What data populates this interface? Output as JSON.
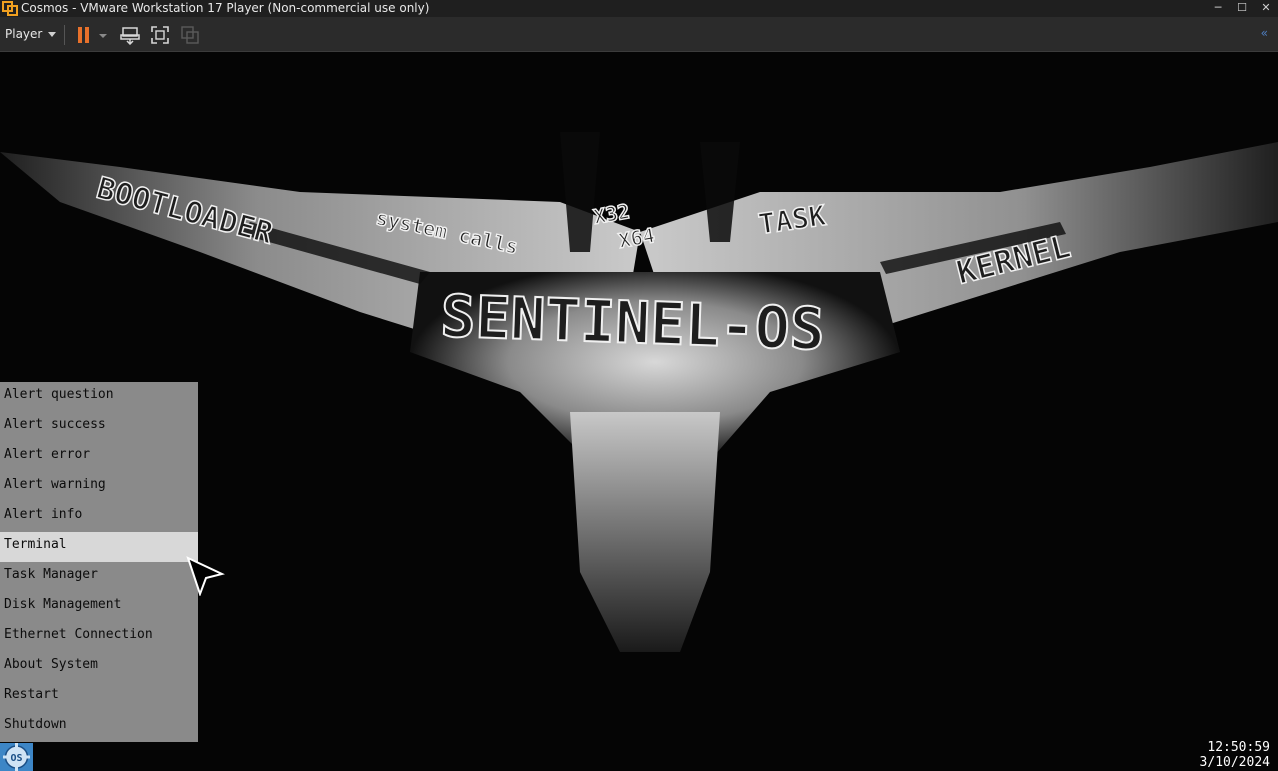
{
  "window": {
    "title": "Cosmos - VMware Workstation 17 Player (Non-commercial use only)",
    "controls": {
      "minimize": "─",
      "maximize": "☐",
      "close": "✕"
    }
  },
  "toolbar": {
    "player_label": "Player",
    "icons": [
      "pause-icon",
      "dropdown-arrow-icon",
      "send-ctrl-alt-del-icon",
      "fullscreen-icon",
      "unity-icon"
    ],
    "collapse_glyph": "«",
    "accent": "#e8712b"
  },
  "wallpaper": {
    "texts": [
      "BOOTLOADER",
      "system calls",
      "X32",
      "X64",
      "TASK",
      "KERNEL",
      "SENTINEL-OS"
    ]
  },
  "start_menu": {
    "items": [
      "Alert question",
      "Alert success",
      "Alert error",
      "Alert warning",
      "Alert info",
      "Terminal",
      "Task Manager",
      "Disk Management",
      "Ethernet Connection",
      "About System",
      "Restart",
      "Shutdown"
    ],
    "highlighted": "Terminal"
  },
  "taskbar": {
    "start_button_label": "OS",
    "time": "12:50:59",
    "date": "3/10/2024"
  }
}
